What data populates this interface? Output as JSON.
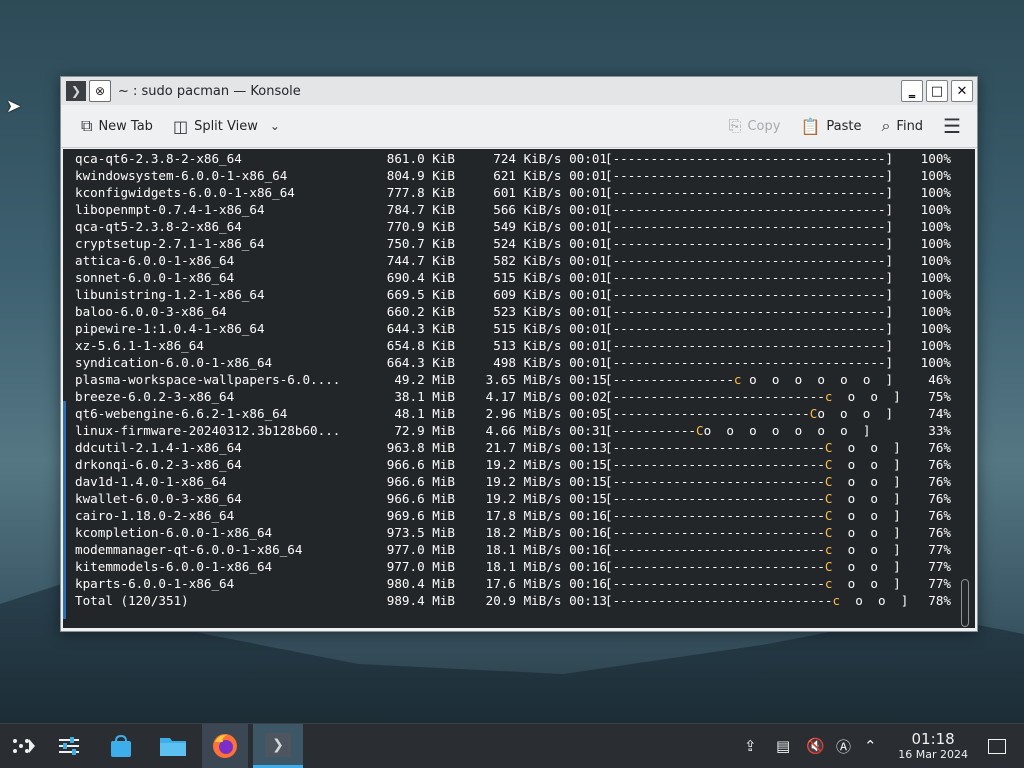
{
  "window": {
    "title": "~ : sudo pacman — Konsole",
    "buttons": [
      "minimize",
      "maximize",
      "close"
    ]
  },
  "toolbar": {
    "new_tab": "New Tab",
    "split_view": "Split View",
    "copy": "Copy",
    "paste": "Paste",
    "find": "Find"
  },
  "terminal": {
    "lines": [
      {
        "name": "qca-qt6-2.3.8-2-x86_64",
        "size": "861.0 KiB",
        "speed": "724 KiB/s 00:01",
        "bar": "[------------------------------------]",
        "pct": "100%"
      },
      {
        "name": "kwindowsystem-6.0.0-1-x86_64",
        "size": "804.9 KiB",
        "speed": "621 KiB/s 00:01",
        "bar": "[------------------------------------]",
        "pct": "100%"
      },
      {
        "name": "kconfigwidgets-6.0.0-1-x86_64",
        "size": "777.8 KiB",
        "speed": "601 KiB/s 00:01",
        "bar": "[------------------------------------]",
        "pct": "100%"
      },
      {
        "name": "libopenmpt-0.7.4-1-x86_64",
        "size": "784.7 KiB",
        "speed": "566 KiB/s 00:01",
        "bar": "[------------------------------------]",
        "pct": "100%"
      },
      {
        "name": "qca-qt5-2.3.8-2-x86_64",
        "size": "770.9 KiB",
        "speed": "549 KiB/s 00:01",
        "bar": "[------------------------------------]",
        "pct": "100%"
      },
      {
        "name": "cryptsetup-2.7.1-1-x86_64",
        "size": "750.7 KiB",
        "speed": "524 KiB/s 00:01",
        "bar": "[------------------------------------]",
        "pct": "100%"
      },
      {
        "name": "attica-6.0.0-1-x86_64",
        "size": "744.7 KiB",
        "speed": "582 KiB/s 00:01",
        "bar": "[------------------------------------]",
        "pct": "100%"
      },
      {
        "name": "sonnet-6.0.0-1-x86_64",
        "size": "690.4 KiB",
        "speed": "515 KiB/s 00:01",
        "bar": "[------------------------------------]",
        "pct": "100%"
      },
      {
        "name": "libunistring-1.2-1-x86_64",
        "size": "669.5 KiB",
        "speed": "609 KiB/s 00:01",
        "bar": "[------------------------------------]",
        "pct": "100%"
      },
      {
        "name": "baloo-6.0.0-3-x86_64",
        "size": "660.2 KiB",
        "speed": "523 KiB/s 00:01",
        "bar": "[------------------------------------]",
        "pct": "100%"
      },
      {
        "name": "pipewire-1:1.0.4-1-x86_64",
        "size": "644.3 KiB",
        "speed": "515 KiB/s 00:01",
        "bar": "[------------------------------------]",
        "pct": "100%"
      },
      {
        "name": "xz-5.6.1-1-x86_64",
        "size": "654.8 KiB",
        "speed": "513 KiB/s 00:01",
        "bar": "[------------------------------------]",
        "pct": "100%"
      },
      {
        "name": "syndication-6.0.0-1-x86_64",
        "size": "664.3 KiB",
        "speed": "498 KiB/s 00:01",
        "bar": "[------------------------------------]",
        "pct": "100%"
      },
      {
        "name": "plasma-workspace-wallpapers-6.0....",
        "size": "49.2 MiB",
        "speed": "3.65 MiB/s 00:15",
        "bar_pre": "[----------------",
        "pac": "c",
        "bar_post": " o  o  o  o  o  o  ]",
        "pct": "46%"
      },
      {
        "name": "breeze-6.0.2-3-x86_64",
        "size": "38.1 MiB",
        "speed": "4.17 MiB/s 00:02",
        "bar_pre": "[----------------------------",
        "pac": "c",
        "bar_post": "  o  o  ]",
        "pct": "75%"
      },
      {
        "name": "qt6-webengine-6.6.2-1-x86_64",
        "size": "48.1 MiB",
        "speed": "2.96 MiB/s 00:05",
        "bar_pre": "[--------------------------",
        "pac": "C",
        "bar_post": "o  o  o  ]",
        "pct": "74%"
      },
      {
        "name": "linux-firmware-20240312.3b128b60...",
        "size": "72.9 MiB",
        "speed": "4.66 MiB/s 00:31",
        "bar_pre": "[-----------",
        "pac": "C",
        "bar_post": "o  o  o  o  o  o  o  ]",
        "pct": "33%"
      },
      {
        "name": "ddcutil-2.1.4-1-x86_64",
        "size": "963.8 MiB",
        "speed": "21.7 MiB/s 00:13",
        "bar_pre": "[----------------------------",
        "pac": "C",
        "bar_post": "  o  o  ]",
        "pct": "76%"
      },
      {
        "name": "drkonqi-6.0.2-3-x86_64",
        "size": "966.6 MiB",
        "speed": "19.2 MiB/s 00:15",
        "bar_pre": "[----------------------------",
        "pac": "C",
        "bar_post": "  o  o  ]",
        "pct": "76%"
      },
      {
        "name": "dav1d-1.4.0-1-x86_64",
        "size": "966.6 MiB",
        "speed": "19.2 MiB/s 00:15",
        "bar_pre": "[----------------------------",
        "pac": "C",
        "bar_post": "  o  o  ]",
        "pct": "76%"
      },
      {
        "name": "kwallet-6.0.0-3-x86_64",
        "size": "966.6 MiB",
        "speed": "19.2 MiB/s 00:15",
        "bar_pre": "[----------------------------",
        "pac": "C",
        "bar_post": "  o  o  ]",
        "pct": "76%"
      },
      {
        "name": "cairo-1.18.0-2-x86_64",
        "size": "969.6 MiB",
        "speed": "17.8 MiB/s 00:16",
        "bar_pre": "[----------------------------",
        "pac": "C",
        "bar_post": "  o  o  ]",
        "pct": "76%"
      },
      {
        "name": "kcompletion-6.0.0-1-x86_64",
        "size": "973.5 MiB",
        "speed": "18.2 MiB/s 00:16",
        "bar_pre": "[----------------------------",
        "pac": "C",
        "bar_post": "  o  o  ]",
        "pct": "76%"
      },
      {
        "name": "modemmanager-qt-6.0.0-1-x86_64",
        "size": "977.0 MiB",
        "speed": "18.1 MiB/s 00:16",
        "bar_pre": "[----------------------------",
        "pac": "c",
        "bar_post": "  o  o  ]",
        "pct": "77%"
      },
      {
        "name": "kitemmodels-6.0.0-1-x86_64",
        "size": "977.0 MiB",
        "speed": "18.1 MiB/s 00:16",
        "bar_pre": "[----------------------------",
        "pac": "C",
        "bar_post": "  o  o  ]",
        "pct": "77%"
      },
      {
        "name": "kparts-6.0.0-1-x86_64",
        "size": "980.4 MiB",
        "speed": "17.6 MiB/s 00:16",
        "bar_pre": "[----------------------------",
        "pac": "c",
        "bar_post": "  o  o  ]",
        "pct": "77%"
      },
      {
        "name": "Total (120/351)",
        "size": "989.4 MiB",
        "speed": "20.9 MiB/s 00:13",
        "bar_pre": "[-----------------------------",
        "pac": "c",
        "bar_post": "  o  o  ]",
        "pct": "78%"
      }
    ]
  },
  "taskbar": {
    "clock_time": "01:18",
    "clock_date": "16 Mar 2024",
    "apps": [
      "application-launcher-icon",
      "system-settings-icon",
      "discover-icon",
      "file-manager-icon",
      "firefox-icon",
      "konsole-icon"
    ]
  },
  "colors": {
    "terminal_bg": "#232629",
    "pacman": "#fdbc4b",
    "accent": "#3daee9"
  }
}
